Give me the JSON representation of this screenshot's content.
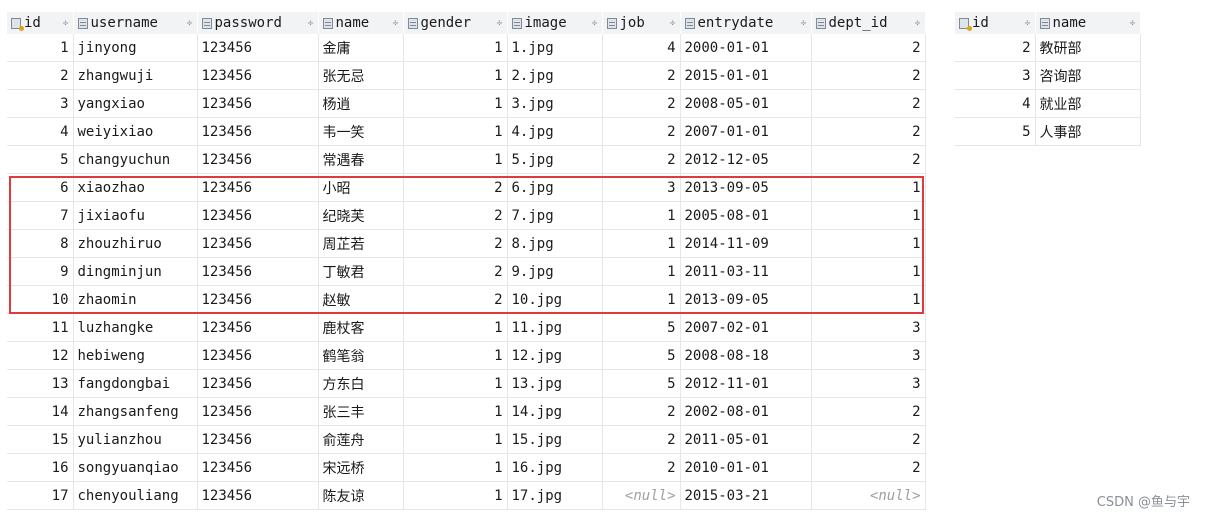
{
  "emp_table": {
    "columns": [
      "id",
      "username",
      "password",
      "name",
      "gender",
      "image",
      "job",
      "entrydate",
      "dept_id"
    ],
    "rows": [
      [
        "1",
        "jinyong",
        "123456",
        "金庸",
        "1",
        "1.jpg",
        "4",
        "2000-01-01",
        "2"
      ],
      [
        "2",
        "zhangwuji",
        "123456",
        "张无忌",
        "1",
        "2.jpg",
        "2",
        "2015-01-01",
        "2"
      ],
      [
        "3",
        "yangxiao",
        "123456",
        "杨逍",
        "1",
        "3.jpg",
        "2",
        "2008-05-01",
        "2"
      ],
      [
        "4",
        "weiyixiao",
        "123456",
        "韦一笑",
        "1",
        "4.jpg",
        "2",
        "2007-01-01",
        "2"
      ],
      [
        "5",
        "changyuchun",
        "123456",
        "常遇春",
        "1",
        "5.jpg",
        "2",
        "2012-12-05",
        "2"
      ],
      [
        "6",
        "xiaozhao",
        "123456",
        "小昭",
        "2",
        "6.jpg",
        "3",
        "2013-09-05",
        "1"
      ],
      [
        "7",
        "jixiaofu",
        "123456",
        "纪晓芙",
        "2",
        "7.jpg",
        "1",
        "2005-08-01",
        "1"
      ],
      [
        "8",
        "zhouzhiruo",
        "123456",
        "周芷若",
        "2",
        "8.jpg",
        "1",
        "2014-11-09",
        "1"
      ],
      [
        "9",
        "dingminjun",
        "123456",
        "丁敏君",
        "2",
        "9.jpg",
        "1",
        "2011-03-11",
        "1"
      ],
      [
        "10",
        "zhaomin",
        "123456",
        "赵敏",
        "2",
        "10.jpg",
        "1",
        "2013-09-05",
        "1"
      ],
      [
        "11",
        "luzhangke",
        "123456",
        "鹿杖客",
        "1",
        "11.jpg",
        "5",
        "2007-02-01",
        "3"
      ],
      [
        "12",
        "hebiweng",
        "123456",
        "鹤笔翁",
        "1",
        "12.jpg",
        "5",
        "2008-08-18",
        "3"
      ],
      [
        "13",
        "fangdongbai",
        "123456",
        "方东白",
        "1",
        "13.jpg",
        "5",
        "2012-11-01",
        "3"
      ],
      [
        "14",
        "zhangsanfeng",
        "123456",
        "张三丰",
        "1",
        "14.jpg",
        "2",
        "2002-08-01",
        "2"
      ],
      [
        "15",
        "yulianzhou",
        "123456",
        "俞莲舟",
        "1",
        "15.jpg",
        "2",
        "2011-05-01",
        "2"
      ],
      [
        "16",
        "songyuanqiao",
        "123456",
        "宋远桥",
        "1",
        "16.jpg",
        "2",
        "2010-01-01",
        "2"
      ],
      [
        "17",
        "chenyouliang",
        "123456",
        "陈友谅",
        "1",
        "17.jpg",
        "<null>",
        "2015-03-21",
        "<null>"
      ]
    ],
    "highlighted_ids": [
      "6",
      "7",
      "8",
      "9",
      "10"
    ],
    "highlight_color": "#e03a3a"
  },
  "dept_table": {
    "columns": [
      "id",
      "name"
    ],
    "rows": [
      [
        "2",
        "教研部"
      ],
      [
        "3",
        "咨询部"
      ],
      [
        "4",
        "就业部"
      ],
      [
        "5",
        "人事部"
      ]
    ]
  },
  "icons": {
    "key_column": "key-column-icon",
    "column": "column-icon",
    "sort": "sort-arrows-icon"
  },
  "sort_glyph": "÷",
  "watermark": "CSDN @鱼与宇"
}
